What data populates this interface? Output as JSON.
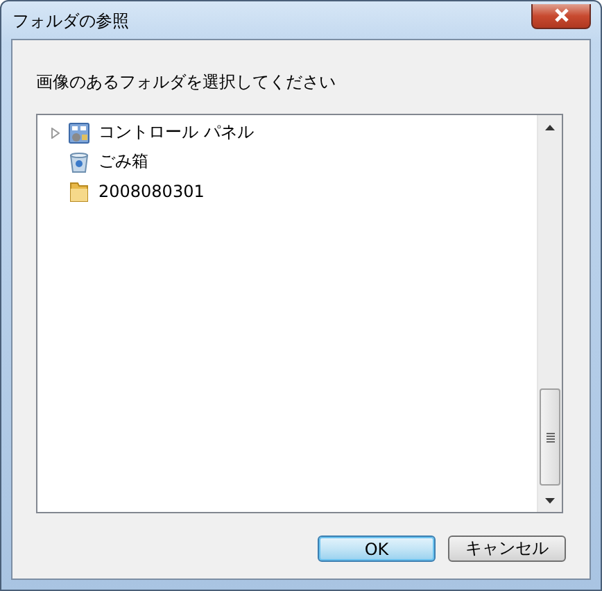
{
  "window": {
    "title": "フォルダの参照"
  },
  "prompt": "画像のあるフォルダを選択してください",
  "tree": {
    "items": [
      {
        "label": "コントロール パネル",
        "kind": "control-panel",
        "expandable": true,
        "expanded": false
      },
      {
        "label": "ごみ箱",
        "kind": "recycle-bin",
        "expandable": false
      },
      {
        "label": "2008080301",
        "kind": "folder",
        "expandable": false
      }
    ]
  },
  "buttons": [
    {
      "label": "OK",
      "default": true
    },
    {
      "label": "キャンセル",
      "default": false
    }
  ]
}
